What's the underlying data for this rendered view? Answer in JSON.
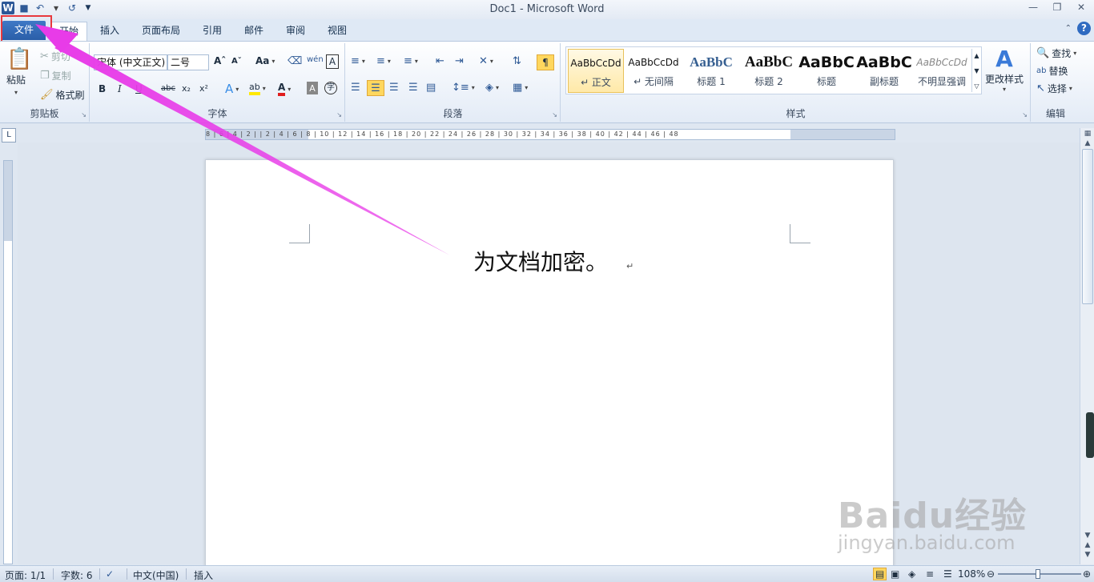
{
  "window": {
    "title": "Doc1 - Microsoft Word"
  },
  "qat": {
    "logo": "W",
    "items": [
      "save-icon",
      "undo-icon",
      "redo-icon",
      "customize-icon"
    ]
  },
  "tabs": [
    "文件",
    "开始",
    "插入",
    "页面布局",
    "引用",
    "邮件",
    "审阅",
    "视图"
  ],
  "ribbon": {
    "clipboard": {
      "label": "剪贴板",
      "paste": "粘贴",
      "cut": "剪切",
      "copy": "复制",
      "format_painter": "格式刷"
    },
    "font": {
      "label": "字体",
      "font_name": "宋体 (中文正文)",
      "font_size": "二号",
      "aa": "Aa",
      "color_a": "A"
    },
    "paragraph": {
      "label": "段落"
    },
    "styles": {
      "label": "样式",
      "items": [
        {
          "sample": "AaBbCcDd",
          "name": "↵ 正文"
        },
        {
          "sample": "AaBbCcDd",
          "name": "↵ 无间隔"
        },
        {
          "sample": "AaBbC",
          "name": "标题 1"
        },
        {
          "sample": "AaBbC",
          "name": "标题 2"
        },
        {
          "sample": "AaBbC",
          "name": "标题"
        },
        {
          "sample": "AaBbC",
          "name": "副标题"
        },
        {
          "sample": "AaBbCcDd",
          "name": "不明显强调"
        }
      ],
      "change_styles": "更改样式"
    },
    "editing": {
      "label": "编辑",
      "find": "查找",
      "replace": "替换",
      "select": "选择"
    }
  },
  "ruler": {
    "ticks": "8 | 6 | 4 | 2 |   | 2 | 4 | 6 | 8 | 10 | 12 | 14 | 16 | 18 | 20 | 22 | 24 | 26 | 28 | 30 | 32 | 34 | 36 | 38 | 40 | 42 | 44 | 46 | 48"
  },
  "document": {
    "text": "为文档加密。",
    "para_mark": "↵"
  },
  "status": {
    "page": "页面: 1/1",
    "words": "字数: 6",
    "language": "中文(中国)",
    "mode": "插入",
    "zoom": "108%",
    "zoom_level": 1.08
  },
  "watermark": {
    "brand": "Baidu经验",
    "url": "jingyan.baidu.com"
  },
  "colors": {
    "annotation_arrow": "#e83be8",
    "highlight_box": "#e8393d",
    "file_tab": "#2a5ea8"
  }
}
